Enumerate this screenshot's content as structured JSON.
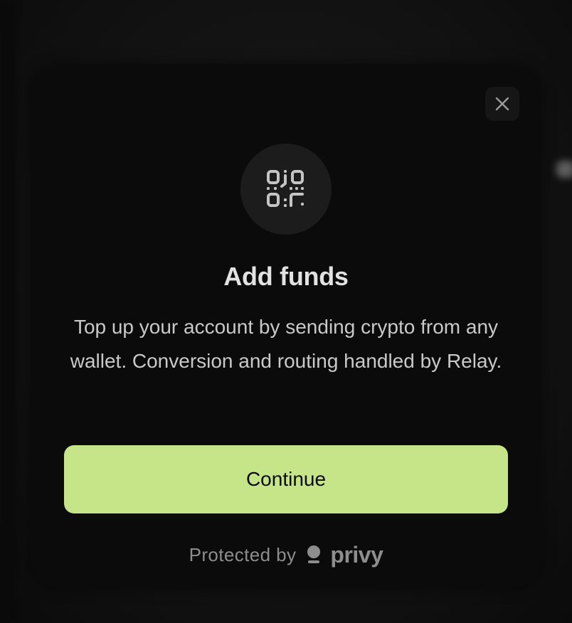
{
  "modal": {
    "title": "Add funds",
    "description": "Top up your account by sending crypto from any wallet. Conversion and routing handled by Relay.",
    "icon": "qr-code-icon",
    "close_icon": "close-icon"
  },
  "actions": {
    "continue_label": "Continue"
  },
  "footer": {
    "protected_label": "Protected by",
    "brand": "privy",
    "brand_icon": "privy-logo-icon"
  },
  "colors": {
    "accent": "#c6e588",
    "modal_background": "#0b0b0b",
    "icon_circle": "#1c1c1c",
    "muted_text": "#8d8d8d"
  }
}
